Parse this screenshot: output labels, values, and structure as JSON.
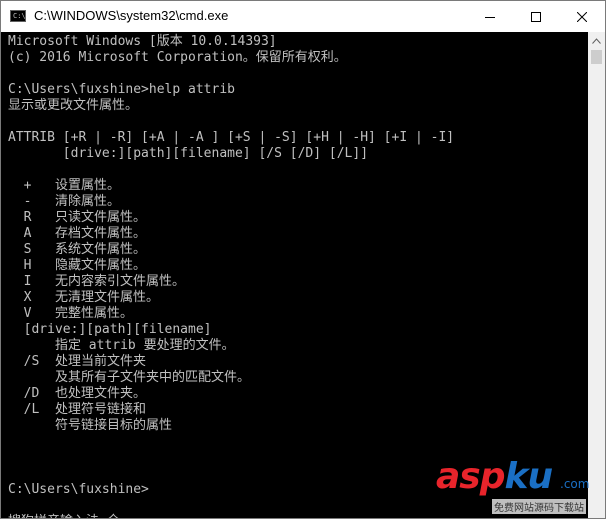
{
  "window": {
    "title": "C:\\WINDOWS\\system32\\cmd.exe",
    "icon": "cmd-icon",
    "icon_glyph": "C:\\"
  },
  "console": {
    "lines": [
      "Microsoft Windows [版本 10.0.14393]",
      "(c) 2016 Microsoft Corporation。保留所有权利。",
      "",
      "C:\\Users\\fuxshine>help attrib",
      "显示或更改文件属性。",
      "",
      "ATTRIB [+R | -R] [+A | -A ] [+S | -S] [+H | -H] [+I | -I]",
      "       [drive:][path][filename] [/S [/D] [/L]]",
      "",
      "  +   设置属性。",
      "  -   清除属性。",
      "  R   只读文件属性。",
      "  A   存档文件属性。",
      "  S   系统文件属性。",
      "  H   隐藏文件属性。",
      "  I   无内容索引文件属性。",
      "  X   无清理文件属性。",
      "  V   完整性属性。",
      "  [drive:][path][filename]",
      "      指定 attrib 要处理的文件。",
      "  /S  处理当前文件夹",
      "      及其所有子文件夹中的匹配文件。",
      "  /D  也处理文件夹。",
      "  /L  处理符号链接和",
      "      符号链接目标的属性",
      "",
      "",
      "",
      "C:\\Users\\fuxshine>",
      "",
      "搜狗拼音输入法 全 :"
    ]
  },
  "watermark": {
    "asp": "asp",
    "ku": "ku",
    "com": ".com",
    "sub": "免费网站源码下载站"
  },
  "colors": {
    "console_bg": "#000000",
    "console_text": "#c0c0c0",
    "titlebar_bg": "#ffffff"
  }
}
